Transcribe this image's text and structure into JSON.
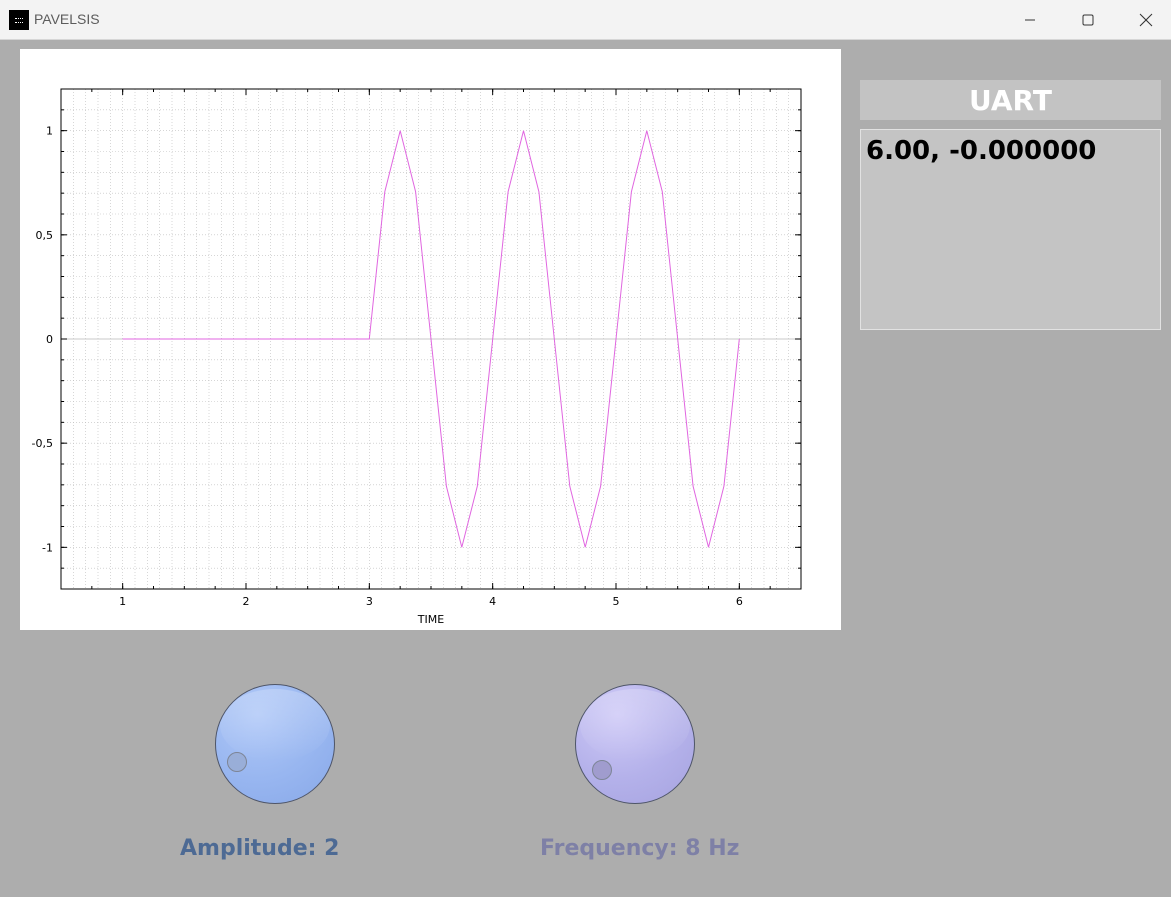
{
  "window": {
    "title": "PAVELSIS",
    "controls": [
      "minimize-icon",
      "maximize-icon",
      "close-icon"
    ]
  },
  "uart": {
    "header": "UART",
    "value": "6.00, -0.000000"
  },
  "knobs": {
    "amplitude_label": "Amplitude: 2",
    "frequency_label": "Frequency: 8 Hz"
  },
  "colors": {
    "background": "#adadad",
    "signal": "#e066e0",
    "amplitude_text": "#4d6a94",
    "frequency_text": "#7e80a6"
  },
  "chart_data": {
    "type": "line",
    "title": "",
    "xlabel": "TIME",
    "ylabel": "",
    "xlim": [
      0.5,
      6.5
    ],
    "ylim": [
      -1.2,
      1.2
    ],
    "xticks": [
      1,
      2,
      3,
      4,
      5,
      6
    ],
    "xtick_labels": [
      "1",
      "2",
      "3",
      "4",
      "5",
      "6"
    ],
    "yticks": [
      1,
      0.5,
      0,
      -0.5,
      -1
    ],
    "ytick_labels": [
      "1",
      "0,5",
      "0",
      "-0,5",
      "-1"
    ],
    "grid": true,
    "series": [
      {
        "color": "#e066e0",
        "x": [
          1,
          1.125,
          1.25,
          1.375,
          1.5,
          1.625,
          1.75,
          1.875,
          2,
          2.125,
          2.25,
          2.375,
          2.5,
          2.625,
          2.75,
          2.875,
          3,
          3.125,
          3.25,
          3.375,
          3.5,
          3.625,
          3.75,
          3.875,
          4,
          4.125,
          4.25,
          4.375,
          4.5,
          4.625,
          4.75,
          4.875,
          5,
          5.125,
          5.25,
          5.375,
          5.5,
          5.625,
          5.75,
          5.875,
          6
        ],
        "y": [
          0,
          0,
          0,
          0,
          0,
          0,
          0,
          0,
          0,
          0,
          0,
          0,
          0,
          0,
          0,
          0,
          0,
          0.7071,
          1,
          0.7071,
          0,
          -0.7071,
          -1,
          -0.7071,
          0,
          0.7071,
          1,
          0.7071,
          0,
          -0.7071,
          -1,
          -0.7071,
          0,
          0.7071,
          1,
          0.7071,
          0,
          -0.7071,
          -1,
          -0.7071,
          0
        ]
      }
    ]
  }
}
